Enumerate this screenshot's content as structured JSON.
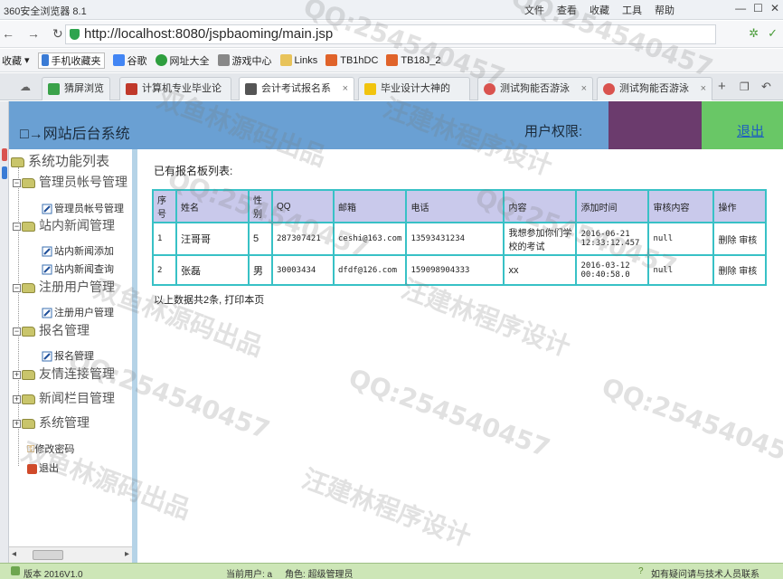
{
  "browser": {
    "app_title": "360安全浏览器 8.1",
    "menu": [
      "文件",
      "查看",
      "收藏",
      "工具",
      "帮助"
    ],
    "url": "http://localhost:8080/jspbaoming/main.jsp",
    "favorites": [
      {
        "label": "收藏",
        "color": "#ffffff"
      },
      {
        "label": "手机收藏夹",
        "color": "#3a7bd5"
      },
      {
        "label": "谷歌",
        "color": "#4285f4"
      },
      {
        "label": "网址大全",
        "color": "#2e9e3e"
      },
      {
        "label": "游戏中心",
        "color": "#888888"
      },
      {
        "label": "Links",
        "color": "#e8c35a"
      },
      {
        "label": "TB1hDC",
        "color": "#e0632a"
      },
      {
        "label": "TB18J_2",
        "color": "#e0632a"
      }
    ],
    "tabs": [
      {
        "label": "猜屏浏览",
        "color": "#3aa24a"
      },
      {
        "label": "计算机专业毕业论",
        "color": "#c0392b"
      },
      {
        "label": "会计考试报名系",
        "color": "#555555"
      },
      {
        "label": "毕业设计大神的",
        "color": "#f1c40f"
      },
      {
        "label": "测试狗能否游泳",
        "color": "#d9534f"
      },
      {
        "label": "测试狗能否游泳",
        "color": "#d9534f"
      }
    ]
  },
  "header": {
    "title": "□→网站后台系统",
    "permission_label": "用户权限:",
    "logout_label": "退出"
  },
  "sidebar": {
    "root": "系统功能列表",
    "groups": [
      {
        "label": "管理员帐号管理",
        "items": [
          "管理员帐号管理"
        ]
      },
      {
        "label": "站内新闻管理",
        "items": [
          "站内新闻添加",
          "站内新闻查询"
        ]
      },
      {
        "label": "注册用户管理",
        "items": [
          "注册用户管理"
        ]
      },
      {
        "label": "报名管理",
        "items": [
          "报名管理"
        ]
      },
      {
        "label": "友情连接管理",
        "items": []
      },
      {
        "label": "新闻栏目管理",
        "items": []
      },
      {
        "label": "系统管理",
        "items": []
      }
    ],
    "extra": [
      "修改密码",
      "退出"
    ]
  },
  "main": {
    "caption": "已有报名板列表:",
    "columns": [
      "序号",
      "姓名",
      "性别",
      "QQ",
      "邮箱",
      "电话",
      "内容",
      "添加时间",
      "审核内容",
      "操作"
    ],
    "rows": [
      [
        "1",
        "汪哥哥",
        "5",
        "287307421",
        "ceshi@163.com",
        "13593431234",
        "我想参加你们学校的考试",
        "2016-06-21 12:33:12.457",
        "null",
        "删除 审核"
      ],
      [
        "2",
        "张磊",
        "男",
        "30003434",
        "dfdf@126.com",
        "159098904333",
        "xx",
        "2016-03-12 00:40:58.0",
        "null",
        "删除 审核"
      ]
    ],
    "footer_note": "以上数据共2条, 打印本页"
  },
  "status": {
    "version": "版本 2016V1.0",
    "current_user": "当前用户: a",
    "role": "角色: 超级管理员",
    "contact": "如有疑问请与技术人员联系"
  },
  "watermarks": [
    "QQ:254540457",
    "汪建林程序设计",
    "双鱼林源码出品"
  ]
}
